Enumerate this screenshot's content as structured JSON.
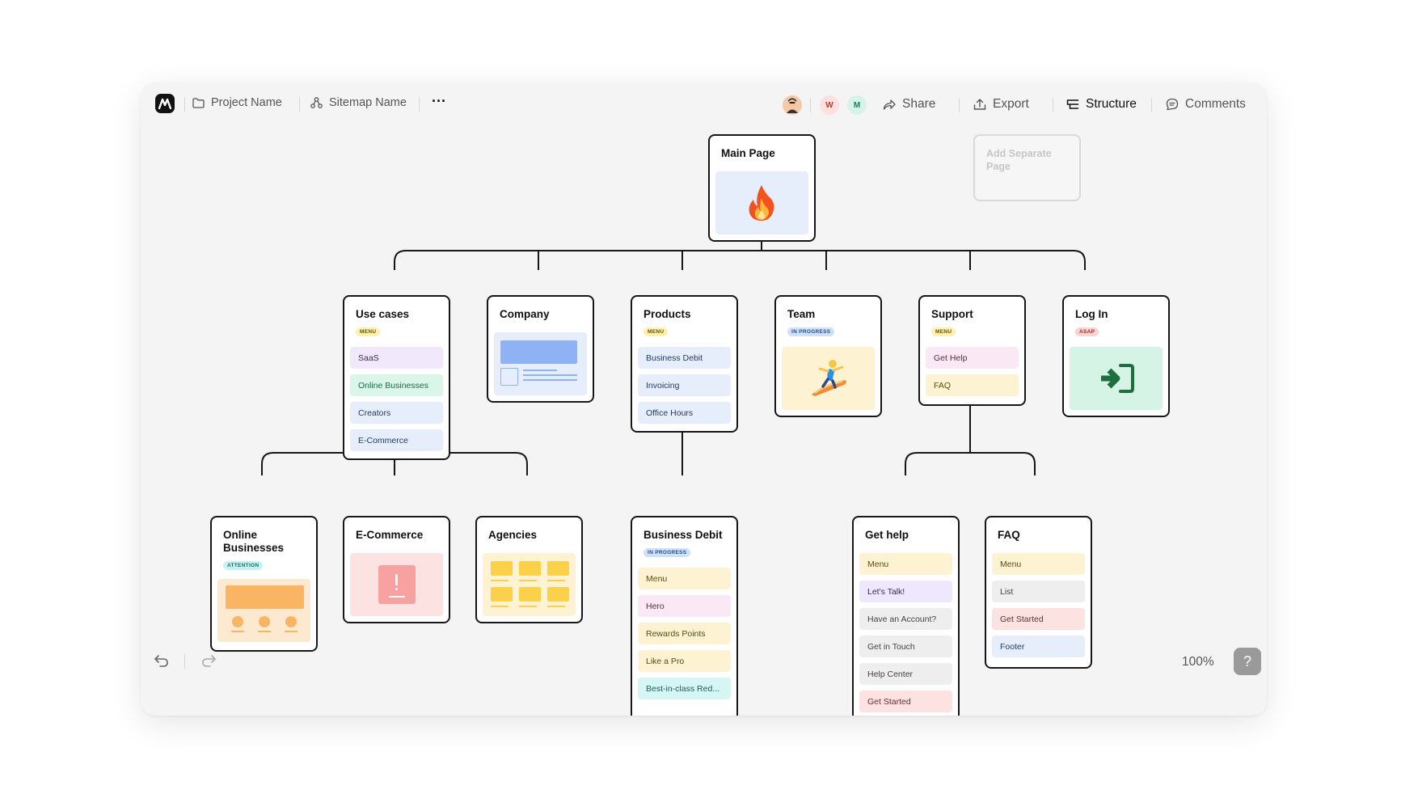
{
  "topbar": {
    "project_label": "Project Name",
    "sitemap_label": "Sitemap Name",
    "more_label": "···",
    "avatars": [
      {
        "initial": "",
        "bg": "#f4c9a8",
        "color": "#333"
      },
      {
        "initial": "W",
        "bg": "#fde0e0",
        "color": "#c0392b"
      },
      {
        "initial": "M",
        "bg": "#d5f4e6",
        "color": "#16805b"
      }
    ],
    "share_label": "Share",
    "export_label": "Export",
    "structure_label": "Structure",
    "comments_label": "Comments"
  },
  "nodes": {
    "main": {
      "title": "Main Page"
    },
    "add_separate": {
      "title": "Add Separate Page"
    },
    "use_cases": {
      "title": "Use cases",
      "badge": "MENU",
      "items": [
        {
          "label": "SaaS",
          "bg": "#f1e8fb",
          "color": "#3a2d58"
        },
        {
          "label": "Online Businesses",
          "bg": "#d9f6e9",
          "color": "#1d6b4a"
        },
        {
          "label": "Creators",
          "bg": "#e6eefc",
          "color": "#233a66"
        },
        {
          "label": "E-Commerce",
          "bg": "#e6eefc",
          "color": "#233a66"
        }
      ]
    },
    "company": {
      "title": "Company"
    },
    "products": {
      "title": "Products",
      "badge": "MENU",
      "items": [
        {
          "label": "Business Debit",
          "bg": "#e6eefc",
          "color": "#233a66"
        },
        {
          "label": "Invoicing",
          "bg": "#e6eefc",
          "color": "#233a66"
        },
        {
          "label": "Office Hours",
          "bg": "#e6eefc",
          "color": "#233a66"
        }
      ]
    },
    "team": {
      "title": "Team",
      "badge": "IN PROGRESS"
    },
    "support": {
      "title": "Support",
      "badge": "MENU",
      "items": [
        {
          "label": "Get Help",
          "bg": "#fae8f4",
          "color": "#5a2d4a"
        },
        {
          "label": "FAQ",
          "bg": "#fdf3d2",
          "color": "#5b4a10"
        }
      ]
    },
    "login": {
      "title": "Log In",
      "badge": "ASAP"
    },
    "online_businesses": {
      "title": "Online Businesses",
      "badge": "ATTENTION"
    },
    "ecommerce": {
      "title": "E-Commerce"
    },
    "agencies": {
      "title": "Agencies"
    },
    "business_debit": {
      "title": "Business Debit",
      "badge": "IN PROGRESS",
      "items": [
        {
          "label": "Menu",
          "bg": "#fdf3d2",
          "color": "#5b4a10"
        },
        {
          "label": "Hero",
          "bg": "#fae8f4",
          "color": "#5a2d4a"
        },
        {
          "label": "Rewards Points",
          "bg": "#fdf3d2",
          "color": "#5b4a10"
        },
        {
          "label": "Like a Pro",
          "bg": "#fdf3d2",
          "color": "#5b4a10"
        },
        {
          "label": "Best-in-class Red...",
          "bg": "#d5f6f5",
          "color": "#1e5e5c"
        }
      ]
    },
    "get_help": {
      "title": "Get help",
      "items": [
        {
          "label": "Menu",
          "bg": "#fdf3d2",
          "color": "#5b4a10"
        },
        {
          "label": "Let's Talk!",
          "bg": "#efe7fb",
          "color": "#3a2d58"
        },
        {
          "label": "Have an Account?",
          "bg": "#eeeeee",
          "color": "#444"
        },
        {
          "label": "Get in Touch",
          "bg": "#eeeeee",
          "color": "#444"
        },
        {
          "label": "Help Center",
          "bg": "#eeeeee",
          "color": "#444"
        },
        {
          "label": "Get Started",
          "bg": "#fde2e2",
          "color": "#6a2d2d"
        }
      ]
    },
    "faq": {
      "title": "FAQ",
      "items": [
        {
          "label": "Menu",
          "bg": "#fdf3d2",
          "color": "#5b4a10"
        },
        {
          "label": "List",
          "bg": "#eeeeee",
          "color": "#444"
        },
        {
          "label": "Get Started",
          "bg": "#fde2e2",
          "color": "#6a2d2d"
        },
        {
          "label": "Footer",
          "bg": "#e6eefc",
          "color": "#233a66"
        }
      ]
    }
  },
  "badges": {
    "menu": {
      "bg": "#fdf0b0",
      "color": "#6b5300"
    },
    "in_progress": {
      "bg": "#cfe0fb",
      "color": "#2a4f8a"
    },
    "asap": {
      "bg": "#fbd3d3",
      "color": "#a32a2a"
    },
    "attention": {
      "bg": "#c6f3f2",
      "color": "#1b6e6c"
    }
  },
  "bottom": {
    "zoom": "100%",
    "help": "?"
  },
  "icons": {
    "main_page": "fire-icon",
    "team": "surfer-icon",
    "login": "login-arrow-icon"
  }
}
